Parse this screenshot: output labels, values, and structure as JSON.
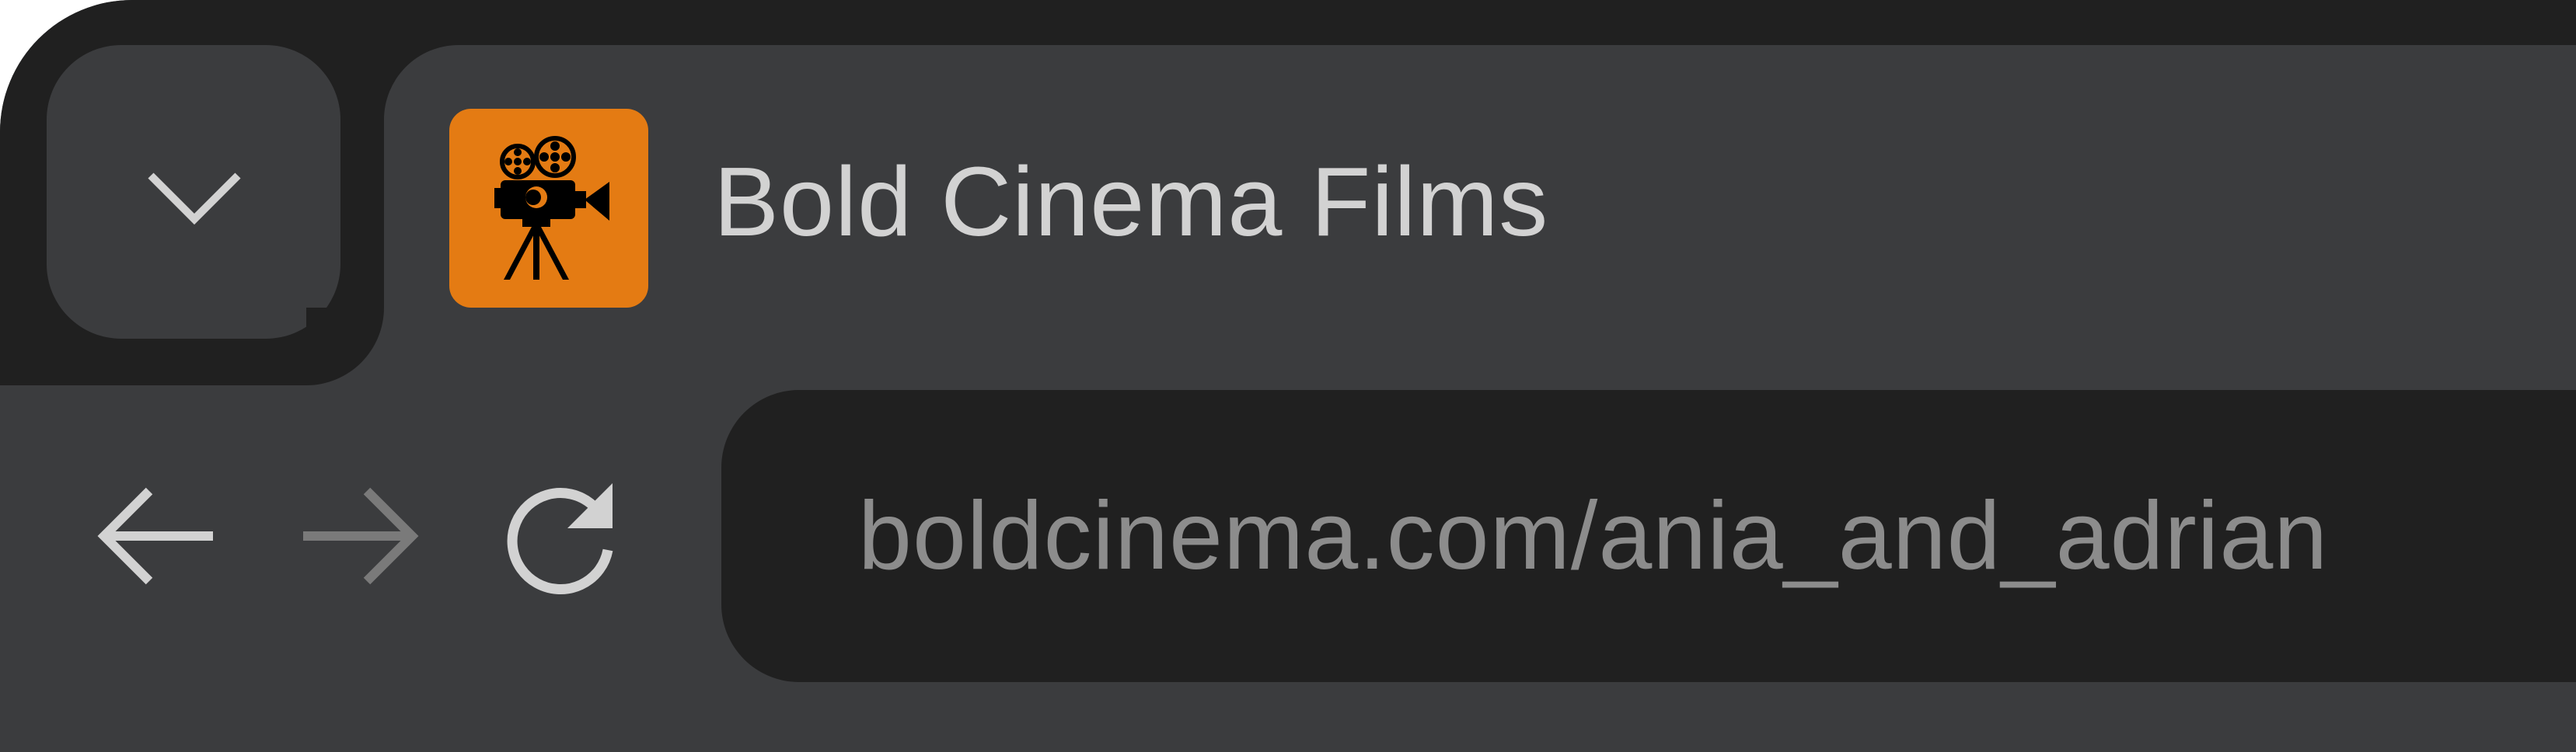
{
  "browser": {
    "tab_list_button": {
      "icon": "chevron-down-icon"
    },
    "active_tab": {
      "title": "Bold Cinema Films",
      "favicon": {
        "icon": "film-projector-icon",
        "background": "#e47b13"
      }
    },
    "navigation": {
      "back": {
        "icon": "arrow-left-icon",
        "enabled": true
      },
      "forward": {
        "icon": "arrow-right-icon",
        "enabled": false
      },
      "reload": {
        "icon": "reload-icon"
      }
    },
    "address_bar": {
      "url": "boldcinema.com/ania_and_adrian"
    }
  },
  "colors": {
    "tabstrip": "#202020",
    "toolbar": "#3b3c3e",
    "address_bar": "#202020",
    "title_text": "#d2d2d2",
    "url_text": "#8c8c8c",
    "icon_enabled": "#d2d2d2",
    "icon_disabled": "#7a7a7a"
  }
}
